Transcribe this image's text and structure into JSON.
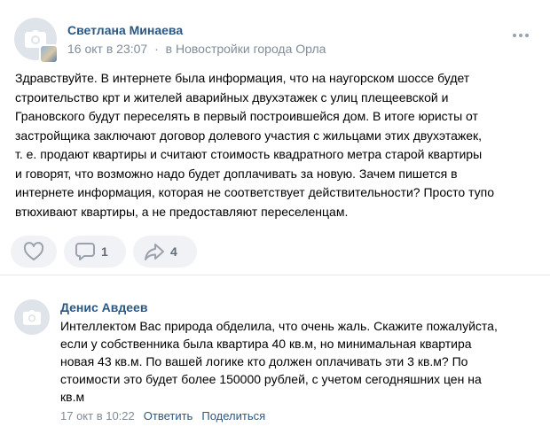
{
  "post": {
    "author": "Светлана Минаева",
    "date": "16 окт в 23:07",
    "separator": "·",
    "group_prefix": "в",
    "group_name": "Новостройки города Орла",
    "lines": [
      "Здравствуйте. В интернете была информация, что на наугорском шоссе будет",
      "строительство крт и жителей аварийных двухэтажек с улиц плещеевской и",
      "Грановского будут переселять в первый построившейся дом. В итоге юристы от",
      "застройщика заключают договор долевого участия с жильцами этих двухэтажек,",
      "т. е. продают квартиры и считают стоимость квадратного метра старой квартиры",
      "и говорят, что возможно надо будет доплачивать за новую. Зачем пишется в",
      "интернете информация, которая не соответствует действительности? Просто тупо",
      "втюхивают квартиры, а не предоставляют переселенцам."
    ],
    "comments_count": "1",
    "shares_count": "4"
  },
  "comment": {
    "author": "Денис Авдеев",
    "lines": [
      "Интеллектом Вас природа обделила, что очень жаль. Скажите пожалуйста,",
      "если у собственника была квартира 40 кв.м, но минимальная квартира",
      "новая 43 кв.м. По вашей логике кто должен оплачивать эти 3 кв.м? По",
      "стоимости это будет более 150000 рублей, с учетом сегодняшних цен на",
      "кв.м"
    ],
    "date": "17 окт в 10:22",
    "reply_label": "Ответить",
    "share_label": "Поделиться"
  },
  "icons": {
    "avatar_placeholder": "camera-icon",
    "badge": "group-avatar-icon",
    "more": "more-horizontal-icon",
    "like": "heart-icon",
    "comment": "comment-icon",
    "share": "share-arrow-icon"
  },
  "colors": {
    "link": "#2a5885",
    "muted": "#818c99",
    "button_bg": "#f0f2f5",
    "icon": "#99a2ad"
  }
}
